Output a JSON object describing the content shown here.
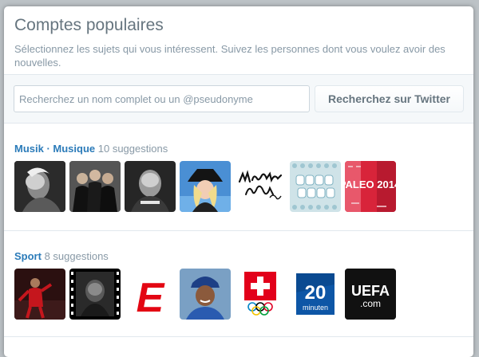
{
  "modal": {
    "title": "Comptes populaires",
    "subtitle": "Sélectionnez les sujets qui vous intéressent. Suivez les personnes dont vous voulez avoir des nouvelles."
  },
  "search": {
    "placeholder": "Recherchez un nom complet ou un @pseudonyme",
    "button_label": "Recherchez sur Twitter"
  },
  "categories": [
    {
      "name": "Musik · Musique",
      "count_text": "10 suggestions",
      "avatars": [
        {
          "icon": "portrait-bw-photo"
        },
        {
          "icon": "band-photo"
        },
        {
          "icon": "portrait-dj-photo"
        },
        {
          "icon": "portrait-woman-hat-photo"
        },
        {
          "icon": "montreux-jazz-festival-logo",
          "text": "Montreux Jazz Festival"
        },
        {
          "icon": "paleo-poster"
        },
        {
          "icon": "paleo-2014-poster",
          "text": "PALEO 2014"
        }
      ]
    },
    {
      "name": "Sport",
      "count_text": "8 suggestions",
      "avatars": [
        {
          "icon": "football-player-photo"
        },
        {
          "icon": "portrait-film-frame-photo"
        },
        {
          "icon": "equipe-logo",
          "text": "E"
        },
        {
          "icon": "baseball-player-photo"
        },
        {
          "icon": "swiss-olympic-logo"
        },
        {
          "icon": "20-minuten-logo",
          "text": "20 minuten"
        },
        {
          "icon": "uefa-logo",
          "text": "UEFA .com"
        }
      ]
    }
  ],
  "colors": {
    "accent": "#2b7bb9",
    "muted": "#8899a6",
    "equipe_red": "#e30613",
    "swiss_red": "#e2001a",
    "minuten_blue": "#0d56a6"
  }
}
